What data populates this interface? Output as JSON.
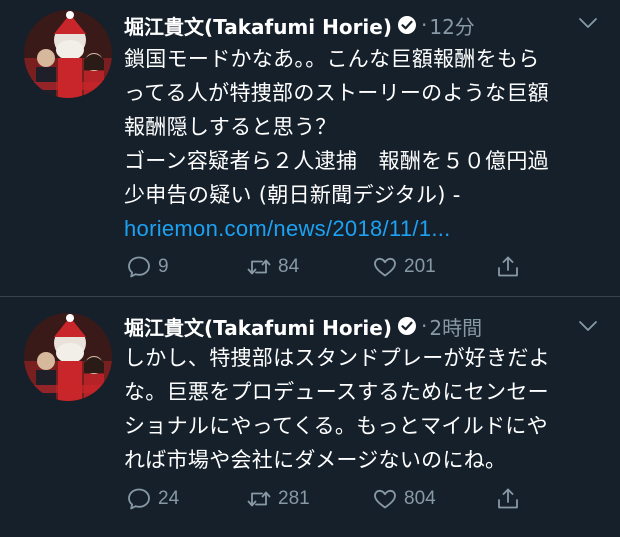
{
  "tweets": [
    {
      "author": "堀江貴文(Takafumi Horie)",
      "dot": "·",
      "time": "12分",
      "lines": [
        "鎖国モードかなあ。。こんな巨額報酬をもら",
        "ってる人が特捜部のストーリーのような巨額",
        "報酬隠しすると思う？",
        "ゴーン容疑者ら２人逮捕　報酬を５０億円過",
        "少申告の疑い (朝日新聞デジタル) -"
      ],
      "link": "horiemon.com/news/2018/11/1...",
      "replies": "9",
      "retweets": "84",
      "likes": "201"
    },
    {
      "author": "堀江貴文(Takafumi Horie)",
      "dot": "·",
      "time": "2時間",
      "lines": [
        "しかし、特捜部はスタンドプレーが好きだよ",
        "な。巨悪をプロデュースするためにセンセー",
        "ショナルにやってくる。もっとマイルドにや",
        "れば市場や会社にダメージないのにね。"
      ],
      "replies": "24",
      "retweets": "281",
      "likes": "804"
    }
  ],
  "colors": {
    "background": "#15202b",
    "text": "#ffffff",
    "secondary": "#8899a6",
    "link": "#1da1f2",
    "divider": "#38444d"
  },
  "icons": [
    "verified-badge-icon",
    "chevron-down-icon",
    "reply-icon",
    "retweet-icon",
    "like-icon",
    "share-icon"
  ]
}
